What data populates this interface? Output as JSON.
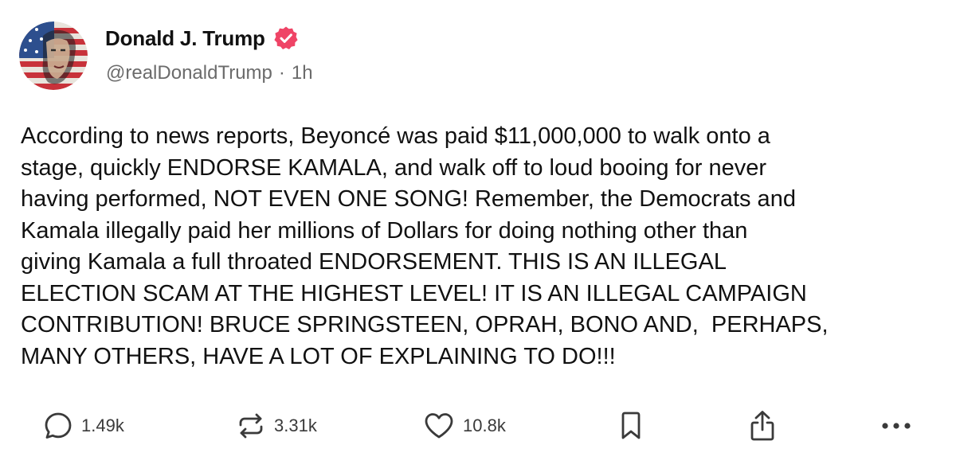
{
  "post": {
    "author": {
      "display_name": "Donald J. Trump",
      "handle": "@realDonaldTrump",
      "time_ago": "1h",
      "separator": "·",
      "verified": true
    },
    "body": "According to news reports, Beyoncé was paid $11,000,000 to walk onto a\nstage, quickly ENDORSE KAMALA, and walk off to loud booing for never\nhaving performed, NOT EVEN ONE SONG! Remember, the Democrats and\nKamala illegally paid her millions of Dollars for doing nothing other than\ngiving Kamala a full throated ENDORSEMENT. THIS IS AN ILLEGAL\nELECTION SCAM AT THE HIGHEST LEVEL! IT IS AN ILLEGAL CAMPAIGN\nCONTRIBUTION! BRUCE SPRINGSTEEN, OPRAH, BONO AND,  PERHAPS,\nMANY OTHERS, HAVE A LOT OF EXPLAINING TO DO!!!"
  },
  "actions": {
    "reply": {
      "icon": "reply-icon",
      "count": "1.49k"
    },
    "repost": {
      "icon": "repost-icon",
      "count": "3.31k"
    },
    "like": {
      "icon": "heart-icon",
      "count": "10.8k"
    },
    "bookmark": {
      "icon": "bookmark-icon"
    },
    "share": {
      "icon": "share-icon"
    },
    "more": {
      "icon": "more-icon"
    }
  },
  "colors": {
    "verified_badge": "#ef4466",
    "text": "#111111",
    "muted": "#6b6b6b",
    "icon": "#3a3a3a"
  }
}
